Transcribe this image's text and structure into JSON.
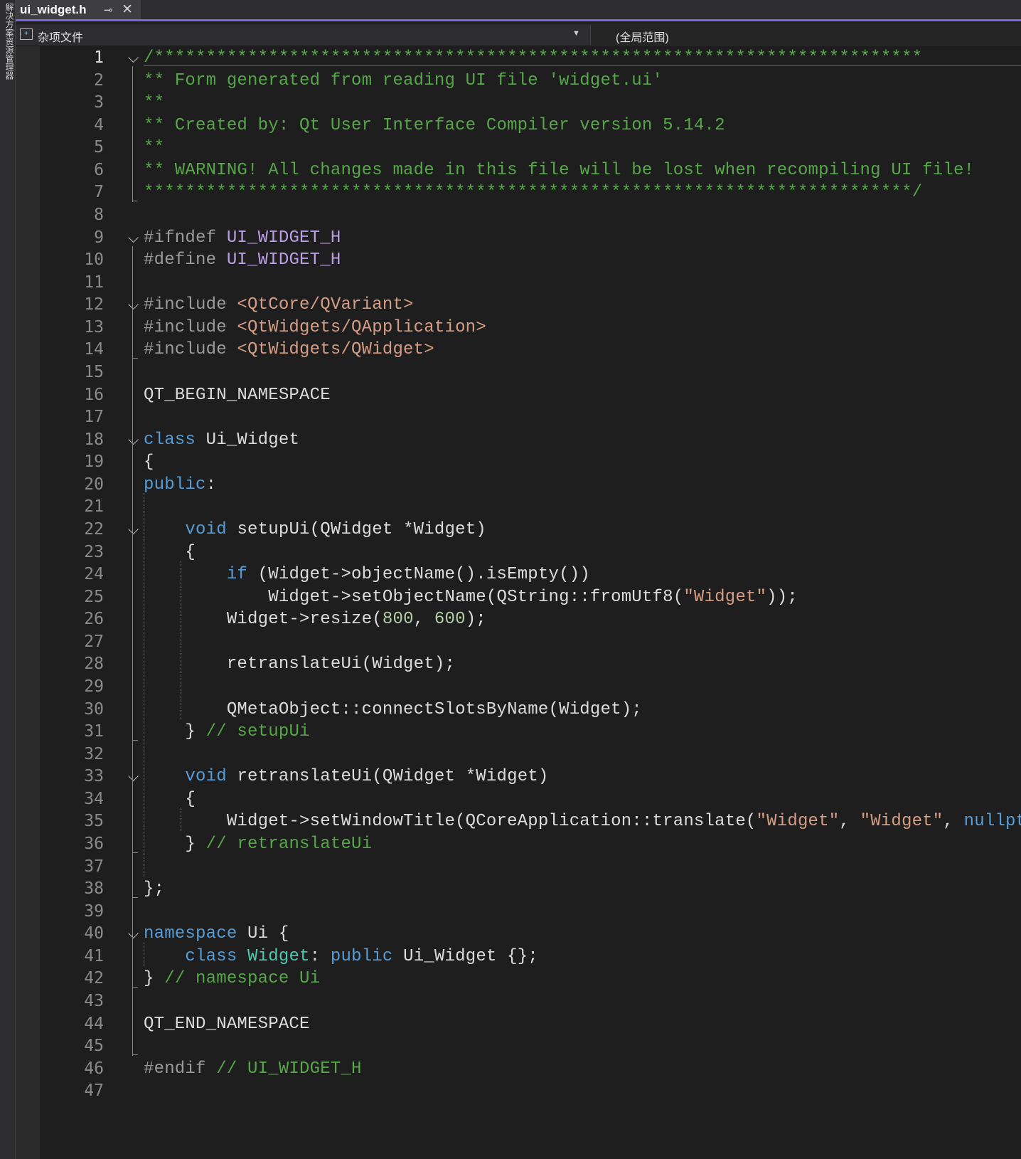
{
  "left_panel": {
    "label": "解决方案资源管理器"
  },
  "tab": {
    "title": "ui_widget.h",
    "pin": "⊸",
    "close": "✕"
  },
  "navbar": {
    "file_scope": "杂项文件",
    "global_scope": "(全局范围)"
  },
  "current_line": 1,
  "folds": [
    1,
    9,
    12,
    18,
    22,
    33,
    40
  ],
  "lines": [
    [
      [
        "cmt",
        "/**************************************************************************"
      ]
    ],
    [
      [
        "cmt",
        "** Form generated from reading UI file 'widget.ui'"
      ]
    ],
    [
      [
        "cmt",
        "**"
      ]
    ],
    [
      [
        "cmt",
        "** Created by: Qt User Interface Compiler version 5.14.2"
      ]
    ],
    [
      [
        "cmt",
        "**"
      ]
    ],
    [
      [
        "cmt",
        "** WARNING! All changes made in this file will be lost when recompiling UI file!"
      ]
    ],
    [
      [
        "cmt",
        "**************************************************************************/"
      ]
    ],
    [],
    [
      [
        "pp",
        "#ifndef "
      ],
      [
        "mac",
        "UI_WIDGET_H"
      ]
    ],
    [
      [
        "pp",
        "#define "
      ],
      [
        "mac",
        "UI_WIDGET_H"
      ]
    ],
    [],
    [
      [
        "pp",
        "#include "
      ],
      [
        "str",
        "<QtCore/QVariant>"
      ]
    ],
    [
      [
        "pp",
        "#include "
      ],
      [
        "str",
        "<QtWidgets/QApplication>"
      ]
    ],
    [
      [
        "pp",
        "#include "
      ],
      [
        "str",
        "<QtWidgets/QWidget>"
      ]
    ],
    [],
    [
      [
        "plain",
        "QT_BEGIN_NAMESPACE"
      ]
    ],
    [],
    [
      [
        "kw",
        "class "
      ],
      [
        "plain",
        "Ui_Widget"
      ]
    ],
    [
      [
        "plain",
        "{"
      ]
    ],
    [
      [
        "kw",
        "public"
      ],
      [
        "plain",
        ":"
      ]
    ],
    [],
    [
      [
        "plain",
        "    "
      ],
      [
        "kw",
        "void "
      ],
      [
        "plain",
        "setupUi(QWidget *Widget)"
      ]
    ],
    [
      [
        "plain",
        "    {"
      ]
    ],
    [
      [
        "plain",
        "        "
      ],
      [
        "kw",
        "if "
      ],
      [
        "plain",
        "(Widget->objectName().isEmpty())"
      ]
    ],
    [
      [
        "plain",
        "            Widget->setObjectName(QString::fromUtf8("
      ],
      [
        "str",
        "\"Widget\""
      ],
      [
        "plain",
        "));"
      ]
    ],
    [
      [
        "plain",
        "        Widget->resize("
      ],
      [
        "num",
        "800"
      ],
      [
        "plain",
        ", "
      ],
      [
        "num",
        "600"
      ],
      [
        "plain",
        ");"
      ]
    ],
    [],
    [
      [
        "plain",
        "        retranslateUi(Widget);"
      ]
    ],
    [],
    [
      [
        "plain",
        "        QMetaObject::connectSlotsByName(Widget);"
      ]
    ],
    [
      [
        "plain",
        "    } "
      ],
      [
        "cmt",
        "// setupUi"
      ]
    ],
    [],
    [
      [
        "plain",
        "    "
      ],
      [
        "kw",
        "void "
      ],
      [
        "plain",
        "retranslateUi(QWidget *Widget)"
      ]
    ],
    [
      [
        "plain",
        "    {"
      ]
    ],
    [
      [
        "plain",
        "        Widget->setWindowTitle(QCoreApplication::translate("
      ],
      [
        "str",
        "\"Widget\""
      ],
      [
        "plain",
        ", "
      ],
      [
        "str",
        "\"Widget\""
      ],
      [
        "plain",
        ", "
      ],
      [
        "kw",
        "nullptr"
      ],
      [
        "plain",
        "));"
      ]
    ],
    [
      [
        "plain",
        "    } "
      ],
      [
        "cmt",
        "// retranslateUi"
      ]
    ],
    [],
    [
      [
        "plain",
        "};"
      ]
    ],
    [],
    [
      [
        "kw",
        "namespace "
      ],
      [
        "plain",
        "Ui {"
      ]
    ],
    [
      [
        "plain",
        "    "
      ],
      [
        "kw",
        "class "
      ],
      [
        "typ",
        "Widget"
      ],
      [
        "plain",
        ": "
      ],
      [
        "kw",
        "public "
      ],
      [
        "plain",
        "Ui_Widget {};"
      ]
    ],
    [
      [
        "plain",
        "} "
      ],
      [
        "cmt",
        "// namespace Ui"
      ]
    ],
    [],
    [
      [
        "plain",
        "QT_END_NAMESPACE"
      ]
    ],
    [],
    [
      [
        "pp",
        "#endif "
      ],
      [
        "cmt",
        "// UI_WIDGET_H"
      ]
    ],
    []
  ]
}
